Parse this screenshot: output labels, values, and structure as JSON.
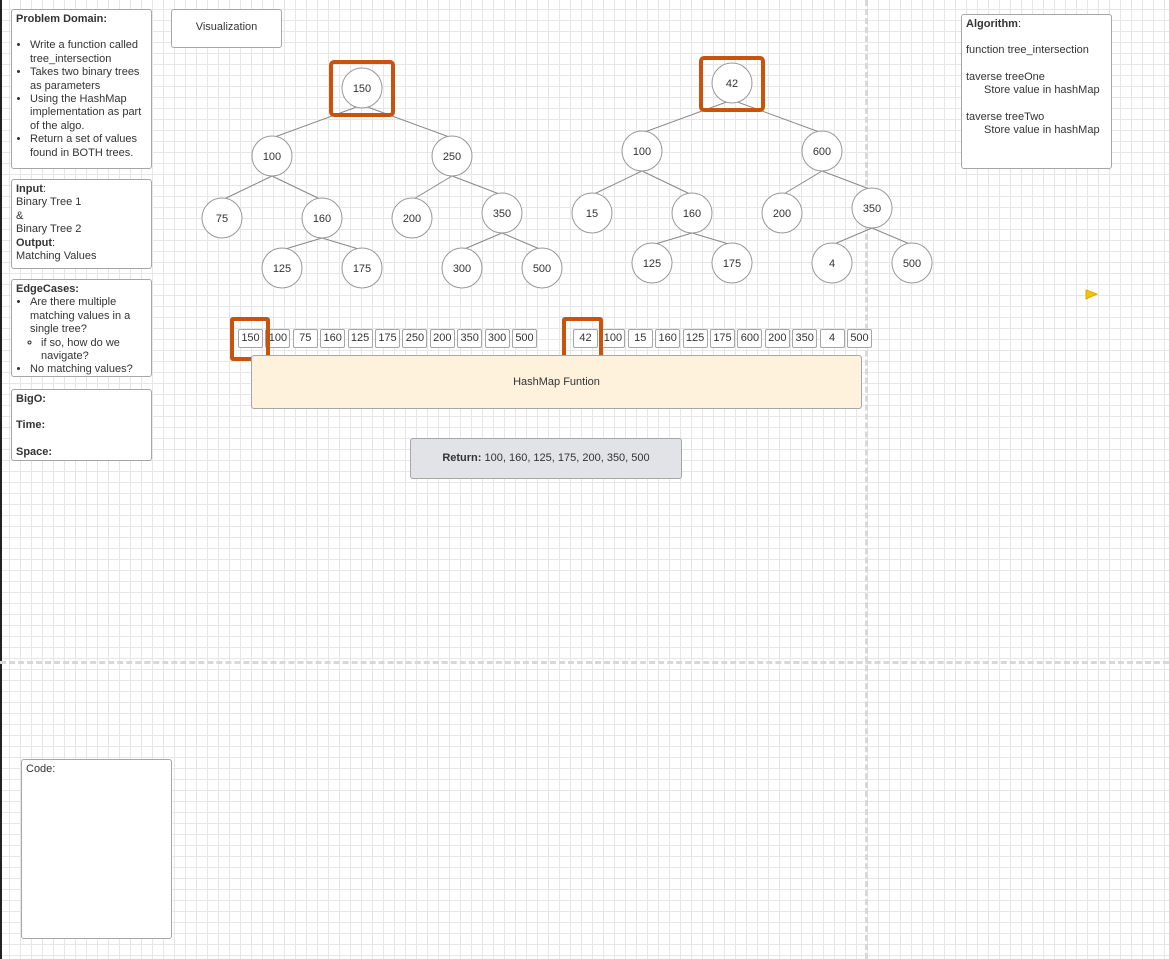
{
  "problem_domain": {
    "title": "Problem Domain:",
    "bullets": [
      "Write a function called tree_intersection",
      "Takes two binary trees as parameters",
      "Using the HashMap implementation as part of the algo.",
      "Return a set of values found in BOTH trees."
    ]
  },
  "io": {
    "input_label": "Input",
    "input_lines": [
      "Binary Tree 1",
      "&",
      "Binary Tree 2"
    ],
    "output_label": "Output",
    "output_value": "Matching Values"
  },
  "edge_cases": {
    "title": "EdgeCases:",
    "bullet1": "Are there multiple matching values in a single tree?",
    "sub_bullet": "if so, how do we navigate?",
    "bullet2": "No matching values?"
  },
  "bigo": {
    "title": "BigO:",
    "time": "Time:",
    "space": "Space:"
  },
  "visualization_label": "Visualization",
  "algorithm": {
    "title": "Algorithm",
    "function_line": "function tree_intersection",
    "step1": "taverse treeOne",
    "step1_detail": "Store value in hashMap",
    "step2": "taverse treeTwo",
    "step2_detail": "Store value in hashMap"
  },
  "tree1": {
    "root": "150",
    "level1": [
      "100",
      "250"
    ],
    "level2": [
      "75",
      "160",
      "200",
      "350"
    ],
    "level3": [
      "125",
      "175",
      "300",
      "500"
    ]
  },
  "tree2": {
    "root": "42",
    "level1": [
      "100",
      "600"
    ],
    "level2": [
      "15",
      "160",
      "200",
      "350"
    ],
    "level3": [
      "125",
      "175",
      "4",
      "500"
    ]
  },
  "array1": [
    "150",
    "100",
    "75",
    "160",
    "125",
    "175",
    "250",
    "200",
    "350",
    "300",
    "500"
  ],
  "array2": [
    "42",
    "100",
    "15",
    "160",
    "125",
    "175",
    "600",
    "200",
    "350",
    "4",
    "500"
  ],
  "hashmap_label": "HashMap Funtion",
  "return": {
    "label": "Return:",
    "values": "100, 160, 125, 175, 200, 350, 500"
  },
  "code_label": "Code:",
  "colors": {
    "highlight": "#c9520d",
    "hashmap_fill": "#fef2dc",
    "return_fill": "#e1e3e7",
    "cursor": "#f5c400"
  }
}
